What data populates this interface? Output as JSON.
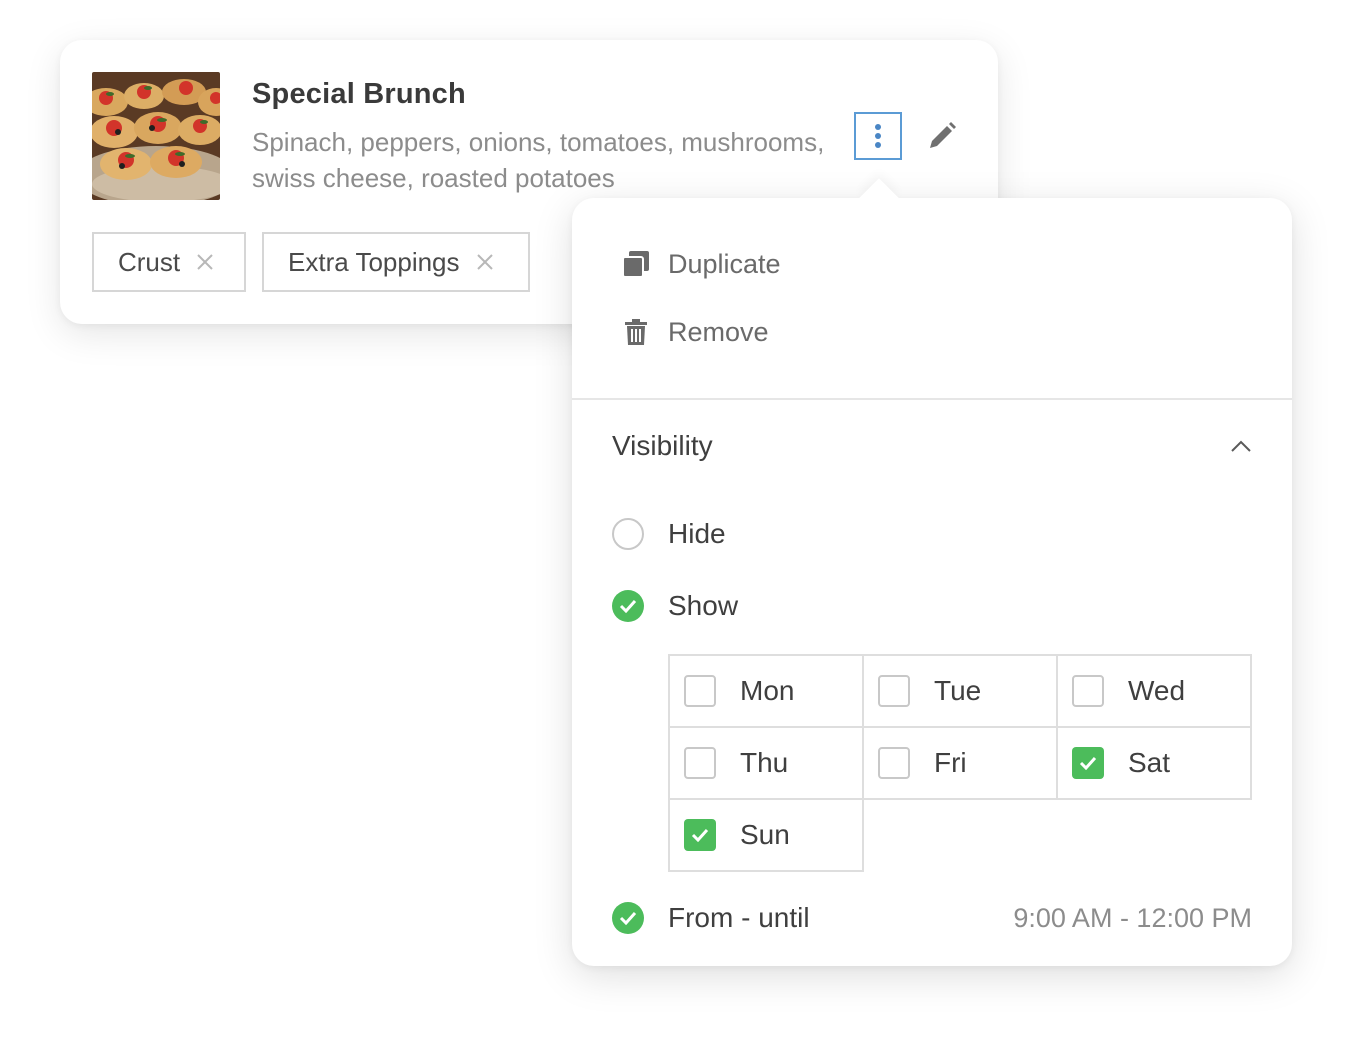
{
  "product": {
    "title": "Special Brunch",
    "description": "Spinach, peppers, onions, tomatoes, mushrooms, swiss cheese, roasted potatoes",
    "tags": [
      "Crust",
      "Extra Toppings"
    ]
  },
  "menu": {
    "duplicate_label": "Duplicate",
    "remove_label": "Remove"
  },
  "visibility": {
    "title": "Visibility",
    "expanded": true,
    "options": {
      "hide": {
        "label": "Hide",
        "selected": false
      },
      "show": {
        "label": "Show",
        "selected": true
      }
    },
    "days": [
      {
        "label": "Mon",
        "checked": false
      },
      {
        "label": "Tue",
        "checked": false
      },
      {
        "label": "Wed",
        "checked": false
      },
      {
        "label": "Thu",
        "checked": false
      },
      {
        "label": "Fri",
        "checked": false
      },
      {
        "label": "Sat",
        "checked": true
      },
      {
        "label": "Sun",
        "checked": true
      }
    ],
    "from_until": {
      "label": "From - until",
      "enabled": true,
      "time_range": "9:00 AM - 12:00 PM"
    }
  },
  "colors": {
    "accent_green": "#4cbc5b",
    "focus_blue": "#5b9bd5"
  }
}
